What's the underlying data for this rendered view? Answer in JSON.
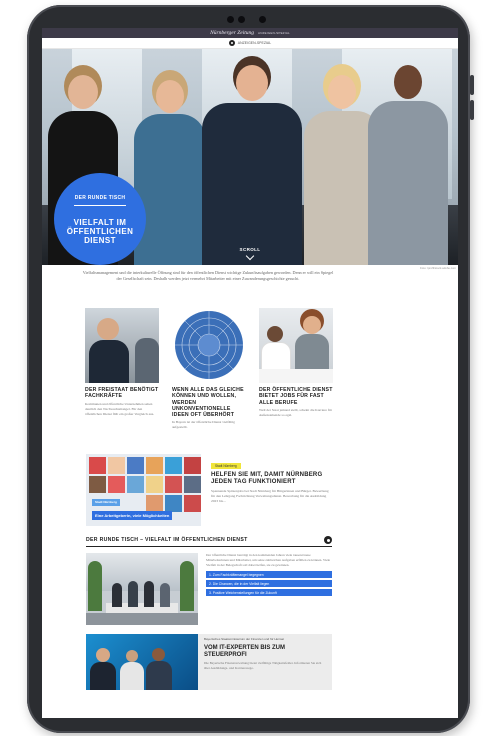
{
  "header": {
    "logo": "Nürnberger Zeitung",
    "sub": "ANZEIGEN-SPEZIAL",
    "subbar_label": "ANZEIGEN-SPEZIAL"
  },
  "hero": {
    "badge_kicker": "DER RUNDE TISCH",
    "badge_title": "VIELFALT IM ÖFFENTLICHEN DIENST",
    "scroll_label": "SCROLL",
    "credit": "Foto: Iprofil/stock.adobe.com"
  },
  "intro": "Vielfaltsmanagement und die interkulturelle Öffnung sind für den öffentlichen Dienst wichtige Zukunftsaufgaben geworden. Denn er will ein Spiegel der Gesellschaft sein. Deshalb werden jetzt vermehrt Mitarbeiter mit einer Zuwanderungsgeschichte gesucht.",
  "cards": [
    {
      "title": "DER FREISTAAT BENÖTIGT FACHKRÄFTE",
      "text": "Kommunen und öffentliche Unternehmen sehen deutlich den Nachwuchsmangel. Für den öffentlichen Dienst fällt ein großer Vergleich aus."
    },
    {
      "title": "WENN ALLE DAS GLEICHE KÖNNEN UND WOLLEN, WERDEN UNKONVENTIONELLE IDEEN OFT ÜBERHÖRT",
      "text": "In Bayern ist der öffentliche Dienst vielfältig aufgestellt."
    },
    {
      "title": "DER ÖFFENTLICHE DIENST BIETET JOBS FÜR FAST ALLE BERUFE",
      "text": "Weil der Staat jemand stellt, scheint die Karriere für Außenstehende so egal."
    }
  ],
  "feature": {
    "tag": "Stadt Nürnberg",
    "title": "HELFEN SIE MIT, DAMIT NÜRNBERG JEDEN TAG FUNKTIONIERT",
    "text": "Spannende Spitzenjobs bei Stadt Nürnberg für Bürgerinnen und Bürger. Bewerbung für den Lehrgang Fachrichtung Verwaltungsdienst. Bewerbung für die Ausbildung 2023 bis...",
    "banner_small": "Stadt Nürnberg",
    "banner_main": "Eine Arbeitgeberin, viele Möglichkeiten"
  },
  "round_table": {
    "title": "DER RUNDE TISCH – VIELFALT IM ÖFFENTLICHEN DIENST",
    "text": "Der öffentliche Dienst benötigt in den kommenden Jahren viele tausend neue Mitarbeiterinnen und Mitarbeiter, um seine zahlreichen Aufgaben erfüllen zu können. Viele Vielfalt in der Belegschaft soll dabei helfen, sie zu gewinnen.",
    "links": [
      "1. Zum Fachkräftemangel begegnen",
      "2. Die Chancen, die in der Vielfalt liegen",
      "3. Positive Weichenstellungen für die Zukunft"
    ]
  },
  "it": {
    "kicker": "Bayerisches Staatsministerium der Finanzen und für Heimat",
    "title": "VOM IT-EXPERTEN BIS ZUM STEUERPROFI",
    "text": "Die Bayerische Finanzverwaltung bietet vielfältige Tätigkeitsfelder. Informieren Sie sich über Ausbildungs- und Karrierewege."
  },
  "colors": {
    "accent": "#2f6fe0",
    "topbar": "#3d3a48",
    "tag": "#f0e53a"
  }
}
